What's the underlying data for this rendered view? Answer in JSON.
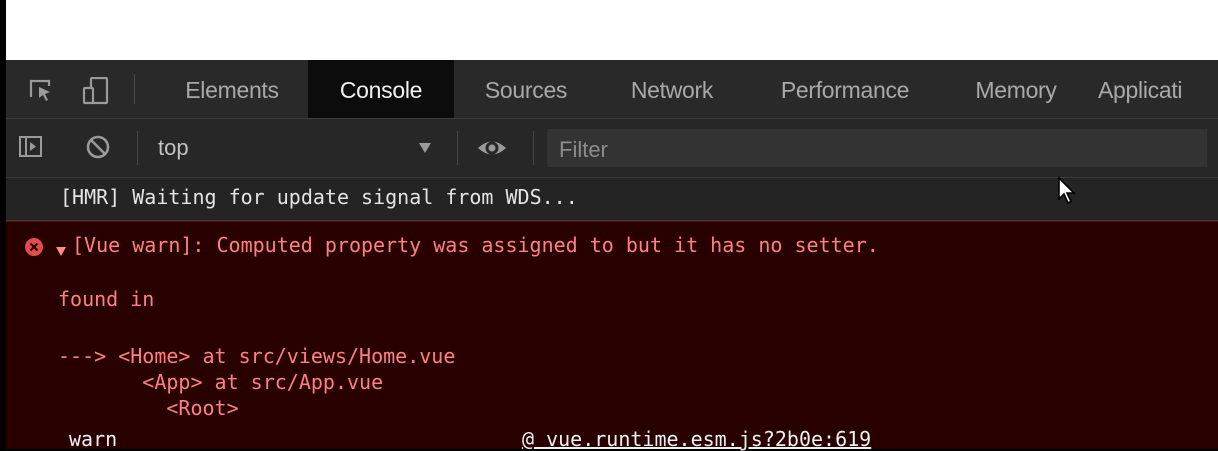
{
  "tabs": [
    {
      "label": "Elements",
      "active": false
    },
    {
      "label": "Console",
      "active": true
    },
    {
      "label": "Sources",
      "active": false
    },
    {
      "label": "Network",
      "active": false
    },
    {
      "label": "Performance",
      "active": false
    },
    {
      "label": "Memory",
      "active": false
    },
    {
      "label": "Applicati",
      "active": false
    }
  ],
  "toolbar": {
    "context": "top",
    "filter_placeholder": "Filter"
  },
  "console": {
    "log": "[HMR] Waiting for update signal from WDS...",
    "error": {
      "message": "[Vue warn]: Computed property was assigned to but it has no setter.",
      "found_in": "found in",
      "trace": [
        "---> <Home> at src/views/Home.vue",
        "       <App> at src/App.vue",
        "         <Root>"
      ],
      "stack_fn": "warn",
      "stack_src": "@ vue.runtime.esm.js?2b0e:619"
    }
  },
  "colors": {
    "error_bg": "#290000",
    "error_text": "#ff8080",
    "active_tab_bg": "#0c0c0c"
  }
}
